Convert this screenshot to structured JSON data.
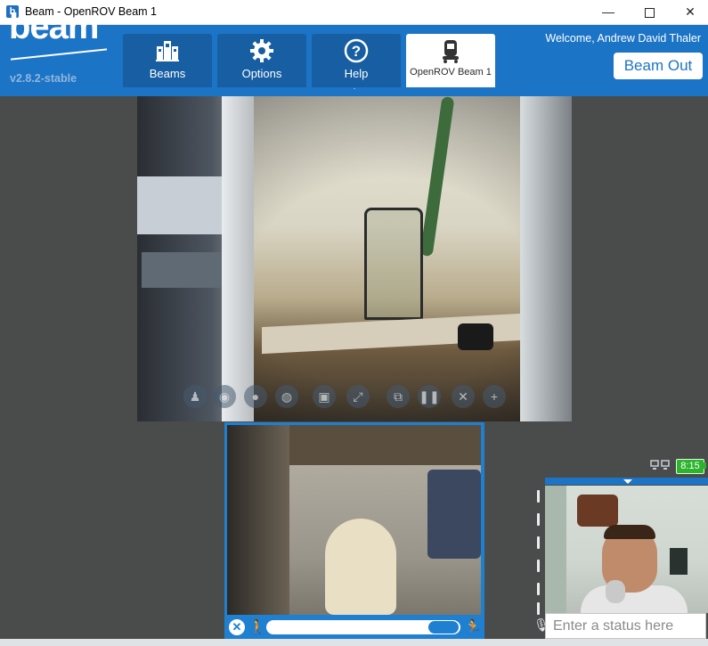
{
  "window": {
    "title": "Beam - OpenROV Beam 1",
    "minimize": "—",
    "close": "✕"
  },
  "header": {
    "logo": "beam",
    "version": "v2.8.2-stable",
    "welcome": "Welcome, Andrew David Thaler",
    "beam_out_label": "Beam Out",
    "accent_color": "#1c74c6"
  },
  "tabs": [
    {
      "label": "Beams",
      "icon": "beams-building-icon"
    },
    {
      "label": "Options",
      "icon": "gear-icon"
    },
    {
      "label": "Help",
      "icon": "question-circle-icon"
    },
    {
      "label": "OpenROV Beam 1",
      "icon": "robot-icon",
      "active": true
    }
  ],
  "main_video": {
    "controls": [
      "people-icon",
      "mic-icon",
      "speaker-icon",
      "pin-icon",
      "screen-share-icon",
      "fullscreen-icon",
      "layout-icon",
      "pause-icon",
      "close-icon",
      "add-icon"
    ]
  },
  "secondary_video": {
    "close": "✕",
    "speed_slider": 0.95
  },
  "status_bar": {
    "battery_time": "8:15",
    "battery_color": "#2db32d"
  },
  "self_view": {
    "status_placeholder": "Enter a status here"
  }
}
